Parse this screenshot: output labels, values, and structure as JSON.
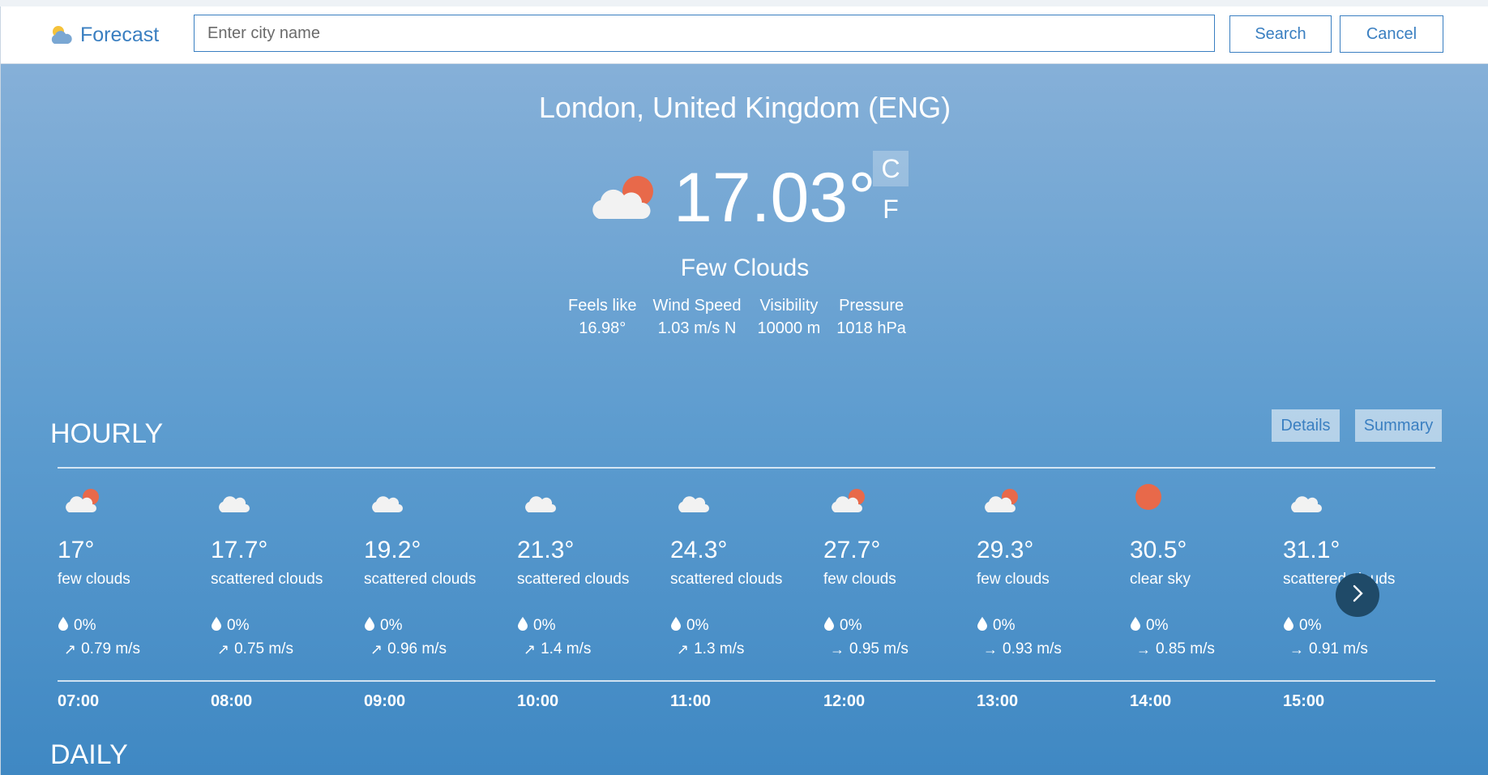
{
  "header": {
    "brand": "Forecast",
    "search_placeholder": "Enter city name",
    "search_label": "Search",
    "cancel_label": "Cancel"
  },
  "current": {
    "location": "London, United Kingdom (ENG)",
    "temperature": "17.03°",
    "unit_c": "C",
    "unit_f": "F",
    "active_unit": "C",
    "condition": "Few Clouds",
    "icon": "few-clouds-icon",
    "stats": [
      {
        "label": "Feels like",
        "value": "16.98°"
      },
      {
        "label": "Wind Speed",
        "value": "1.03 m/s N"
      },
      {
        "label": "Visibility",
        "value": "10000 m"
      },
      {
        "label": "Pressure",
        "value": "1018 hPa"
      }
    ]
  },
  "hourly": {
    "title": "HOURLY",
    "details_label": "Details",
    "summary_label": "Summary",
    "items": [
      {
        "time": "07:00",
        "temp": "17°",
        "desc": "few clouds",
        "rain": "0%",
        "wind": "0.79 m/s",
        "icon": "few-clouds-icon",
        "arrow": "↗"
      },
      {
        "time": "08:00",
        "temp": "17.7°",
        "desc": "scattered clouds",
        "rain": "0%",
        "wind": "0.75 m/s",
        "icon": "scattered-clouds-icon",
        "arrow": "↗"
      },
      {
        "time": "09:00",
        "temp": "19.2°",
        "desc": "scattered clouds",
        "rain": "0%",
        "wind": "0.96 m/s",
        "icon": "scattered-clouds-icon",
        "arrow": "↗"
      },
      {
        "time": "10:00",
        "temp": "21.3°",
        "desc": "scattered clouds",
        "rain": "0%",
        "wind": "1.4 m/s",
        "icon": "scattered-clouds-icon",
        "arrow": "↗"
      },
      {
        "time": "11:00",
        "temp": "24.3°",
        "desc": "scattered clouds",
        "rain": "0%",
        "wind": "1.3 m/s",
        "icon": "scattered-clouds-icon",
        "arrow": "↗"
      },
      {
        "time": "12:00",
        "temp": "27.7°",
        "desc": "few clouds",
        "rain": "0%",
        "wind": "0.95 m/s",
        "icon": "few-clouds-icon",
        "arrow": "→"
      },
      {
        "time": "13:00",
        "temp": "29.3°",
        "desc": "few clouds",
        "rain": "0%",
        "wind": "0.93 m/s",
        "icon": "few-clouds-icon",
        "arrow": "→"
      },
      {
        "time": "14:00",
        "temp": "30.5°",
        "desc": "clear sky",
        "rain": "0%",
        "wind": "0.85 m/s",
        "icon": "clear-sky-icon",
        "arrow": "→"
      },
      {
        "time": "15:00",
        "temp": "31.1°",
        "desc": "scattered clouds",
        "rain": "0%",
        "wind": "0.91 m/s",
        "icon": "scattered-clouds-icon",
        "arrow": "→"
      }
    ]
  },
  "daily": {
    "title": "DAILY"
  },
  "colors": {
    "accent": "#3a7fc1",
    "sun": "#e8694a",
    "cloud": "#f2f2f2",
    "nav_button": "#1f4a68"
  }
}
